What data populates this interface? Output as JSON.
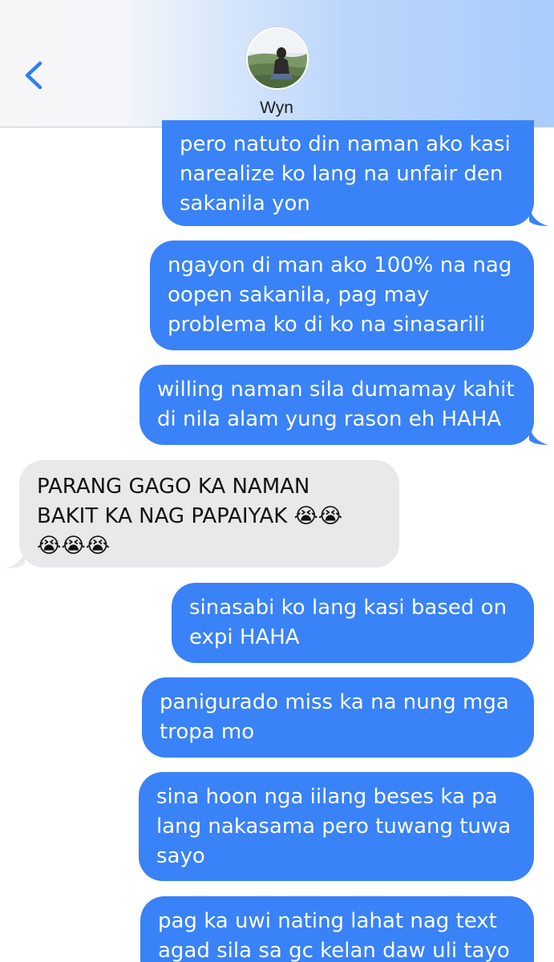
{
  "header": {
    "back_icon": "chevron-left-icon",
    "contact_name": "Wyn",
    "avatar_icon": "profile-photo"
  },
  "colors": {
    "sent_bubble": "#3982f7",
    "received_bubble": "#e9e9eb",
    "accent": "#2f7cf6"
  },
  "messages": [
    {
      "direction": "sent",
      "text": "pero natuto din naman ako kasi\nnarealize ko lang na unfair den\nsakanila yon"
    },
    {
      "direction": "sent",
      "text": "ngayon di man ako 100% na nag\noopen sakanila, pag may\nproblema ko di ko na sinasarili"
    },
    {
      "direction": "sent",
      "text": "willing naman sila dumamay kahit\ndi nila alam yung rason eh HAHA"
    },
    {
      "direction": "received",
      "text": "PARANG GAGO KA NAMAN\nBAKIT KA NAG PAPAIYAK 😭😭\n😭😭😭"
    },
    {
      "direction": "sent",
      "text": "sinasabi ko lang kasi based on\nexpi HAHA"
    },
    {
      "direction": "sent",
      "text": "panigurado miss ka na nung mga\ntropa mo"
    },
    {
      "direction": "sent",
      "text": "sina hoon nga iilang beses ka pa\nlang nakasama pero tuwang tuwa\nsayo"
    },
    {
      "direction": "sent",
      "text": "pag ka uwi nating lahat nag text\nagad sila sa gc kelan daw uli tayo"
    }
  ]
}
